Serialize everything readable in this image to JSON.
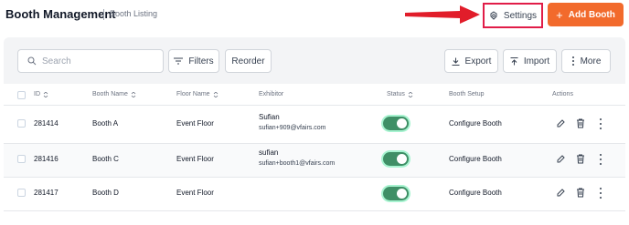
{
  "header": {
    "title": "Booth Management",
    "breadcrumb": "Booth Listing",
    "settings_label": "Settings",
    "add_label": "Add Booth",
    "accent_color": "#f26a2c",
    "highlight_color": "#e11d48"
  },
  "toolbar": {
    "search_placeholder": "Search",
    "filters_label": "Filters",
    "reorder_label": "Reorder",
    "export_label": "Export",
    "import_label": "Import",
    "more_label": "More"
  },
  "table": {
    "columns": [
      "ID",
      "Booth Name",
      "Floor Name",
      "Exhibitor",
      "Status",
      "Booth Setup",
      "Actions"
    ],
    "rows": [
      {
        "id": "281414",
        "booth_name": "Booth A",
        "floor_name": "Event Floor",
        "exhibitor_name": "Sufian",
        "exhibitor_email": "sufian+909@vfairs.com",
        "status_on": true,
        "setup": "Configure Booth"
      },
      {
        "id": "281416",
        "booth_name": "Booth C",
        "floor_name": "Event Floor",
        "exhibitor_name": "sufian",
        "exhibitor_email": "sufian+booth1@vfairs.com",
        "status_on": true,
        "setup": "Configure Booth"
      },
      {
        "id": "281417",
        "booth_name": "Booth D",
        "floor_name": "Event Floor",
        "exhibitor_name": "",
        "exhibitor_email": "",
        "status_on": true,
        "setup": "Configure Booth"
      }
    ]
  }
}
